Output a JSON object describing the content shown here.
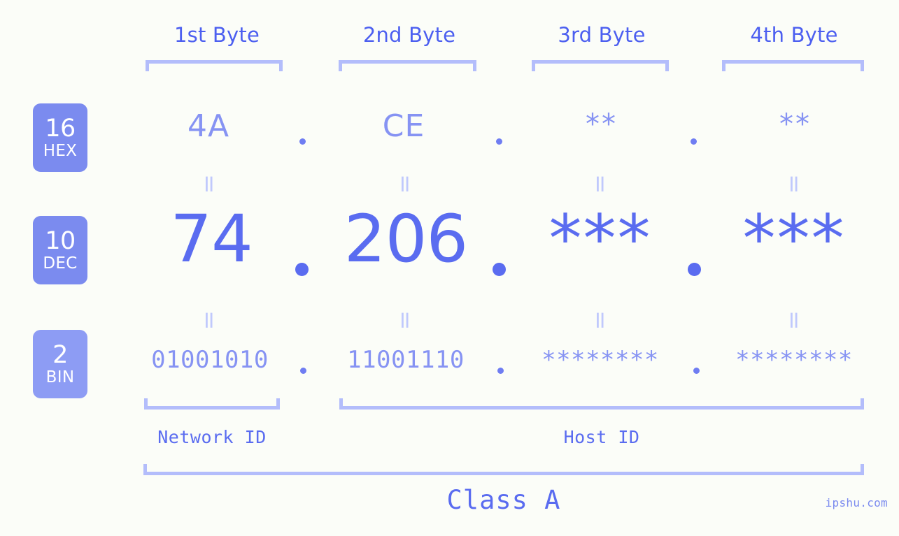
{
  "watermark": "ipshu.com",
  "byte_headers": [
    {
      "label": "1st Byte"
    },
    {
      "label": "2nd Byte"
    },
    {
      "label": "3rd Byte"
    },
    {
      "label": "4th Byte"
    }
  ],
  "bases": [
    {
      "number": "16",
      "name": "HEX"
    },
    {
      "number": "10",
      "name": "DEC"
    },
    {
      "number": "2",
      "name": "BIN"
    }
  ],
  "rows": {
    "hex": {
      "base_number": "16",
      "base_name": "HEX",
      "values": [
        "4A",
        "CE",
        "**",
        "**"
      ],
      "separator": "."
    },
    "dec": {
      "base_number": "10",
      "base_name": "DEC",
      "values": [
        "74",
        "206",
        "***",
        "***"
      ],
      "separator": "."
    },
    "bin": {
      "base_number": "2",
      "base_name": "BIN",
      "values": [
        "01001010",
        "11001110",
        "********",
        "********"
      ],
      "separator": "."
    }
  },
  "equals_sign": "=",
  "id_sections": [
    {
      "label": "Network ID"
    },
    {
      "label": "Host ID"
    }
  ],
  "class_label": "Class A",
  "colors": {
    "background": "#fbfdf8",
    "accent_strong": "#5a6cf0",
    "accent_mid": "#8693f3",
    "accent_light": "#b3bdfb",
    "badge": "#7b8bef",
    "badge_bin": "#8d9cf4",
    "header_text": "#4c5ff0"
  }
}
